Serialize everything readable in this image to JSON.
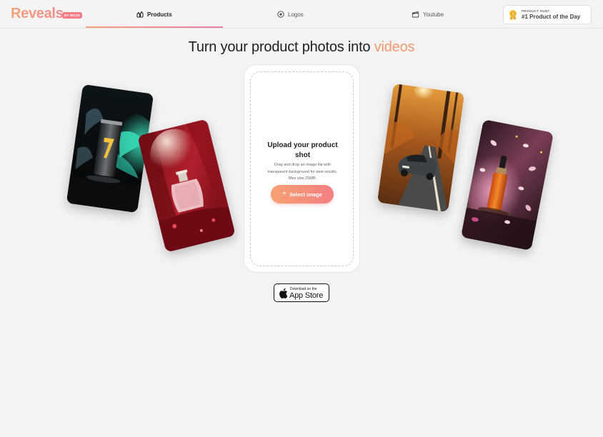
{
  "brand": {
    "name": "Reveals",
    "badge": "BY MOJO"
  },
  "nav": {
    "tabs": [
      {
        "label": "Products",
        "icon": "perfume-bottles-icon",
        "active": true
      },
      {
        "label": "Logos",
        "icon": "star-circle-icon",
        "active": false
      },
      {
        "label": "Youtube",
        "icon": "clapperboard-icon",
        "active": false
      }
    ]
  },
  "product_hunt": {
    "small": "PRODUCT HUNT",
    "big": "#1 Product of the Day",
    "icon": "medal-icon"
  },
  "headline": {
    "text": "Turn your product photos into ",
    "accent": "videos"
  },
  "cards": [
    {
      "name": "energy-drink-can-photo"
    },
    {
      "name": "perfume-bottle-photo"
    },
    {
      "name": "car-on-road-photo"
    },
    {
      "name": "serum-bottle-petals-photo"
    }
  ],
  "upload": {
    "title": "Upload your product shot",
    "description": "Drag and drop an image file with transparent background for best results. Max size 25MB.",
    "button_label": "Select image",
    "button_icon": "plus-icon"
  },
  "appstore": {
    "small": "Download on the",
    "big": "App Store",
    "icon": "apple-icon"
  },
  "colors": {
    "accent": "#f39a6e",
    "accent_pink": "#f37e82",
    "background": "#f3f3f3"
  }
}
